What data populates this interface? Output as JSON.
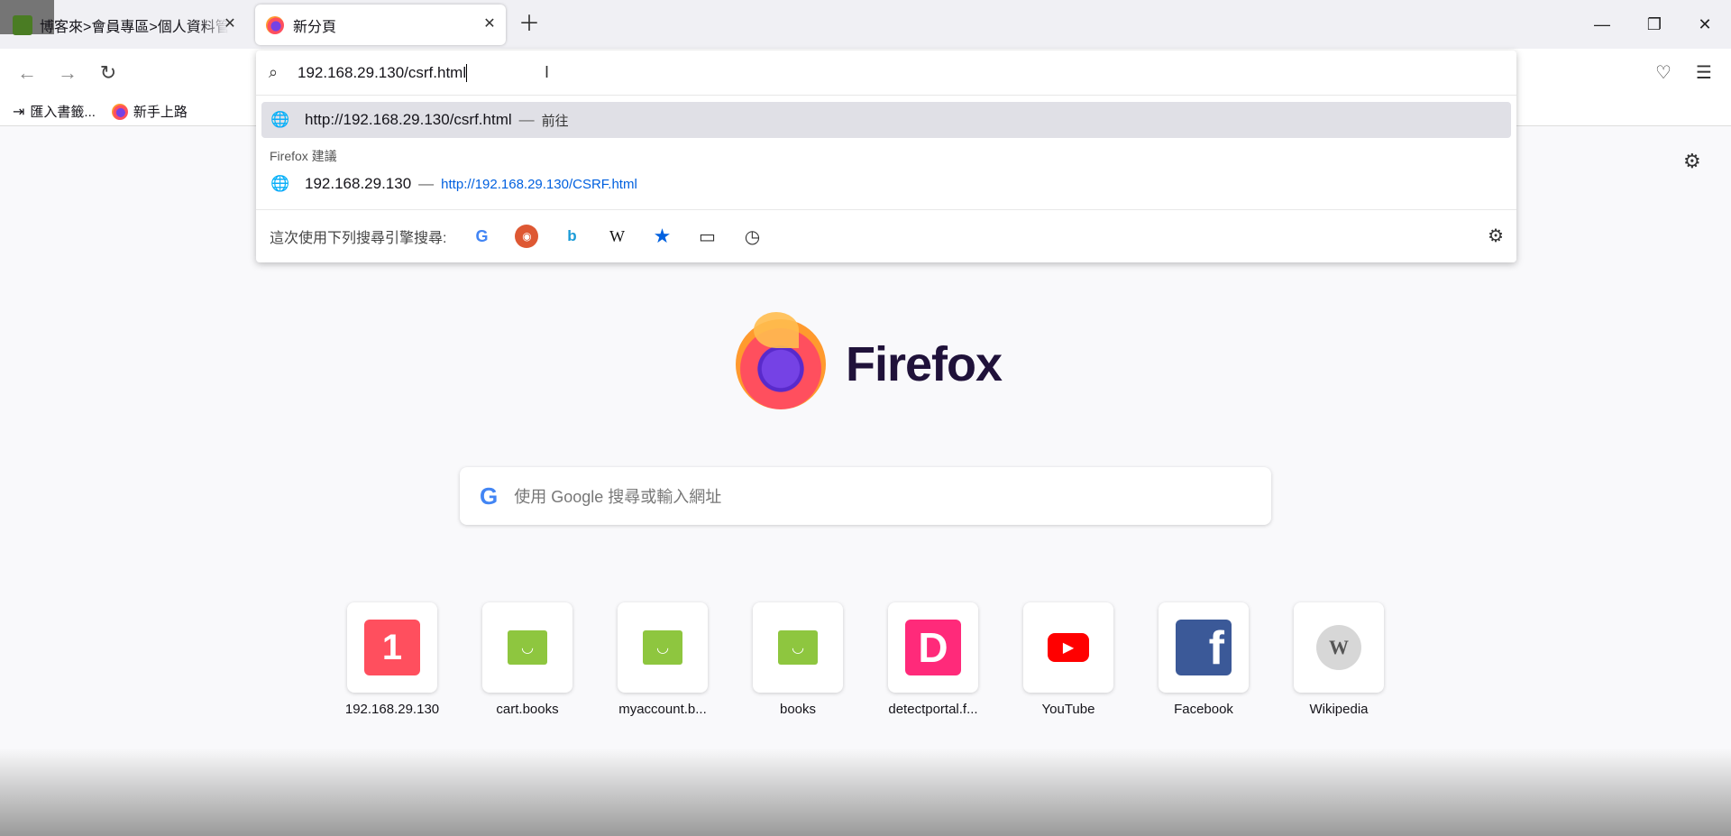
{
  "tabs": [
    {
      "title": "博客來>會員專區>個人資料管理"
    },
    {
      "title": "新分頁"
    }
  ],
  "address_bar": {
    "value": "192.168.29.130/csrf.html"
  },
  "suggestions": {
    "primary": {
      "url": "http://192.168.29.130/csrf.html",
      "action": "前往"
    },
    "header": "Firefox 建議",
    "items": [
      {
        "title": "192.168.29.130",
        "url": "http://192.168.29.130/CSRF.html"
      }
    ]
  },
  "search_engines": {
    "label": "這次使用下列搜尋引擎搜尋:",
    "engines": [
      "google-icon",
      "duckduckgo-icon",
      "bing-icon",
      "wikipedia-icon",
      "bookmarks-icon",
      "tabs-icon",
      "history-icon"
    ]
  },
  "bookmarks": [
    {
      "label": "匯入書籤..."
    },
    {
      "label": "新手上路"
    }
  ],
  "brand": {
    "name": "Firefox"
  },
  "search": {
    "placeholder": "使用 Google 搜尋或輸入網址"
  },
  "top_sites": [
    {
      "label": "192.168.29.130",
      "icon": "one-icon"
    },
    {
      "label": "cart.books",
      "icon": "shopping-bag-icon"
    },
    {
      "label": "myaccount.b...",
      "icon": "shopping-bag-icon"
    },
    {
      "label": "books",
      "icon": "shopping-bag-icon"
    },
    {
      "label": "detectportal.f...",
      "icon": "d-icon"
    },
    {
      "label": "YouTube",
      "icon": "youtube-icon"
    },
    {
      "label": "Facebook",
      "icon": "facebook-icon"
    },
    {
      "label": "Wikipedia",
      "icon": "wikipedia-icon"
    }
  ],
  "colors": {
    "accent": "#0060df",
    "selected_row": "#e0e0e6",
    "tab_strip": "#f0f0f4"
  }
}
